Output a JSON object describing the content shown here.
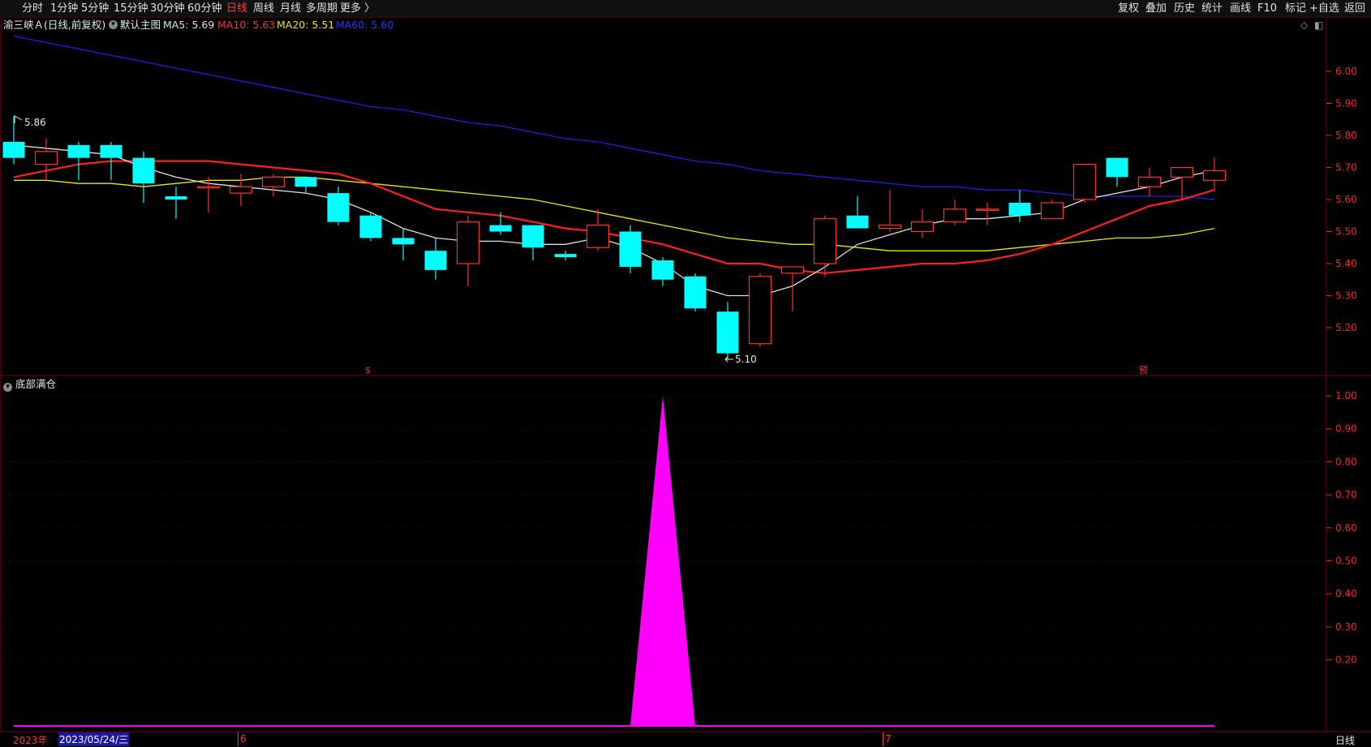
{
  "toolbar": {
    "periods": [
      "分时",
      "1分钟",
      "5分钟",
      "15分钟",
      "30分钟",
      "60分钟",
      "日线",
      "周线",
      "月线",
      "多周期",
      "更多 〉"
    ],
    "active_period": "日线",
    "right_tools": [
      "复权",
      "叠加",
      "历史",
      "统计",
      "画线",
      "F10",
      "标记",
      "+自选",
      "返回"
    ]
  },
  "info": {
    "stock": "渝三峡Ａ(日线,前复权)",
    "template": "默认主图",
    "ma5": "MA5: 5.69",
    "ma10": "MA10: 5.63",
    "ma20": "MA20: 5.51",
    "ma60": "MA60: 5.60"
  },
  "colors": {
    "up": "#ff3030",
    "down": "#00ffff",
    "ma5": "#e0e0e0",
    "ma10": "#ff2020",
    "ma20": "#e8e800",
    "ma60": "#2020e0",
    "signal": "#ff00ff",
    "grid": "#5a0000",
    "axis": "#ff2020"
  },
  "price_axis": {
    "ticks": [
      "6.00",
      "5.90",
      "5.80",
      "5.70",
      "5.60",
      "5.50",
      "5.40",
      "5.30",
      "5.20"
    ],
    "high_label": "5.86",
    "low_label": "5.10",
    "markers": [
      "$",
      "预"
    ]
  },
  "indicator": {
    "title": "底部满仓",
    "ticks": [
      "1.00",
      "0.90",
      "0.80",
      "0.70",
      "0.60",
      "0.50",
      "0.40",
      "0.30",
      "0.20"
    ]
  },
  "date_axis": {
    "year": "2023年",
    "selected_date": "2023/05/24/三",
    "month_marks": [
      "6",
      "7"
    ],
    "period_label": "日线"
  },
  "chart_data": {
    "type": "candlestick",
    "y_range": [
      5.05,
      6.07
    ],
    "candles": [
      {
        "o": 5.78,
        "h": 5.86,
        "l": 5.71,
        "c": 5.73
      },
      {
        "o": 5.71,
        "h": 5.79,
        "l": 5.66,
        "c": 5.75
      },
      {
        "o": 5.77,
        "h": 5.78,
        "l": 5.66,
        "c": 5.73
      },
      {
        "o": 5.77,
        "h": 5.78,
        "l": 5.66,
        "c": 5.73
      },
      {
        "o": 5.73,
        "h": 5.75,
        "l": 5.59,
        "c": 5.65
      },
      {
        "o": 5.61,
        "h": 5.64,
        "l": 5.54,
        "c": 5.6
      },
      {
        "o": 5.64,
        "h": 5.67,
        "l": 5.56,
        "c": 5.64
      },
      {
        "o": 5.62,
        "h": 5.68,
        "l": 5.58,
        "c": 5.64
      },
      {
        "o": 5.64,
        "h": 5.68,
        "l": 5.61,
        "c": 5.67
      },
      {
        "o": 5.67,
        "h": 5.67,
        "l": 5.62,
        "c": 5.64
      },
      {
        "o": 5.62,
        "h": 5.64,
        "l": 5.52,
        "c": 5.53
      },
      {
        "o": 5.55,
        "h": 5.56,
        "l": 5.47,
        "c": 5.48
      },
      {
        "o": 5.48,
        "h": 5.51,
        "l": 5.41,
        "c": 5.46
      },
      {
        "o": 5.44,
        "h": 5.48,
        "l": 5.35,
        "c": 5.38
      },
      {
        "o": 5.4,
        "h": 5.55,
        "l": 5.33,
        "c": 5.53
      },
      {
        "o": 5.52,
        "h": 5.56,
        "l": 5.49,
        "c": 5.5
      },
      {
        "o": 5.52,
        "h": 5.52,
        "l": 5.41,
        "c": 5.45
      },
      {
        "o": 5.43,
        "h": 5.44,
        "l": 5.41,
        "c": 5.42
      },
      {
        "o": 5.45,
        "h": 5.57,
        "l": 5.44,
        "c": 5.52
      },
      {
        "o": 5.5,
        "h": 5.52,
        "l": 5.37,
        "c": 5.39
      },
      {
        "o": 5.41,
        "h": 5.42,
        "l": 5.33,
        "c": 5.35
      },
      {
        "o": 5.36,
        "h": 5.37,
        "l": 5.25,
        "c": 5.26
      },
      {
        "o": 5.25,
        "h": 5.28,
        "l": 5.1,
        "c": 5.12
      },
      {
        "o": 5.15,
        "h": 5.37,
        "l": 5.14,
        "c": 5.36
      },
      {
        "o": 5.37,
        "h": 5.39,
        "l": 5.25,
        "c": 5.39
      },
      {
        "o": 5.4,
        "h": 5.55,
        "l": 5.36,
        "c": 5.54
      },
      {
        "o": 5.55,
        "h": 5.61,
        "l": 5.51,
        "c": 5.51
      },
      {
        "o": 5.51,
        "h": 5.63,
        "l": 5.5,
        "c": 5.52
      },
      {
        "o": 5.5,
        "h": 5.57,
        "l": 5.48,
        "c": 5.53
      },
      {
        "o": 5.53,
        "h": 5.6,
        "l": 5.52,
        "c": 5.57
      },
      {
        "o": 5.57,
        "h": 5.59,
        "l": 5.52,
        "c": 5.57
      },
      {
        "o": 5.59,
        "h": 5.63,
        "l": 5.53,
        "c": 5.55
      },
      {
        "o": 5.54,
        "h": 5.6,
        "l": 5.54,
        "c": 5.59
      },
      {
        "o": 5.6,
        "h": 5.71,
        "l": 5.59,
        "c": 5.71
      },
      {
        "o": 5.73,
        "h": 5.73,
        "l": 5.64,
        "c": 5.67
      },
      {
        "o": 5.64,
        "h": 5.7,
        "l": 5.61,
        "c": 5.67
      },
      {
        "o": 5.67,
        "h": 5.7,
        "l": 5.6,
        "c": 5.7
      },
      {
        "o": 5.66,
        "h": 5.73,
        "l": 5.63,
        "c": 5.69
      }
    ],
    "ma5": [
      5.77,
      5.76,
      5.75,
      5.74,
      5.7,
      5.67,
      5.65,
      5.64,
      5.63,
      5.62,
      5.6,
      5.56,
      5.51,
      5.48,
      5.47,
      5.47,
      5.46,
      5.46,
      5.48,
      5.45,
      5.4,
      5.33,
      5.3,
      5.3,
      5.33,
      5.39,
      5.46,
      5.49,
      5.52,
      5.54,
      5.54,
      5.55,
      5.56,
      5.6,
      5.62,
      5.64,
      5.67,
      5.69
    ],
    "ma10": [
      5.67,
      5.69,
      5.71,
      5.72,
      5.72,
      5.72,
      5.72,
      5.71,
      5.7,
      5.69,
      5.68,
      5.65,
      5.61,
      5.57,
      5.56,
      5.55,
      5.53,
      5.51,
      5.5,
      5.48,
      5.46,
      5.43,
      5.4,
      5.4,
      5.38,
      5.37,
      5.38,
      5.39,
      5.4,
      5.4,
      5.41,
      5.43,
      5.46,
      5.5,
      5.54,
      5.58,
      5.6,
      5.63
    ],
    "ma20": [
      5.66,
      5.66,
      5.65,
      5.65,
      5.64,
      5.65,
      5.66,
      5.66,
      5.67,
      5.67,
      5.66,
      5.65,
      5.64,
      5.63,
      5.62,
      5.61,
      5.6,
      5.58,
      5.56,
      5.54,
      5.52,
      5.5,
      5.48,
      5.47,
      5.46,
      5.46,
      5.45,
      5.44,
      5.44,
      5.44,
      5.44,
      5.45,
      5.46,
      5.47,
      5.48,
      5.48,
      5.49,
      5.51
    ],
    "ma60": [
      6.11,
      6.09,
      6.07,
      6.05,
      6.03,
      6.01,
      5.99,
      5.97,
      5.95,
      5.93,
      5.91,
      5.89,
      5.88,
      5.86,
      5.84,
      5.83,
      5.81,
      5.79,
      5.78,
      5.76,
      5.74,
      5.72,
      5.71,
      5.69,
      5.68,
      5.67,
      5.66,
      5.65,
      5.64,
      5.64,
      5.63,
      5.63,
      5.62,
      5.61,
      5.61,
      5.61,
      5.61,
      5.6
    ],
    "signal_values": [
      0,
      0,
      0,
      0,
      0,
      0,
      0,
      0,
      0,
      0,
      0,
      0,
      0,
      0,
      0,
      0,
      0,
      0,
      0,
      0,
      1,
      0,
      0,
      0,
      0,
      0,
      0,
      0,
      0,
      0,
      0,
      0,
      0,
      0,
      0,
      0,
      0,
      0
    ],
    "signal_range": [
      0,
      1.05
    ]
  }
}
